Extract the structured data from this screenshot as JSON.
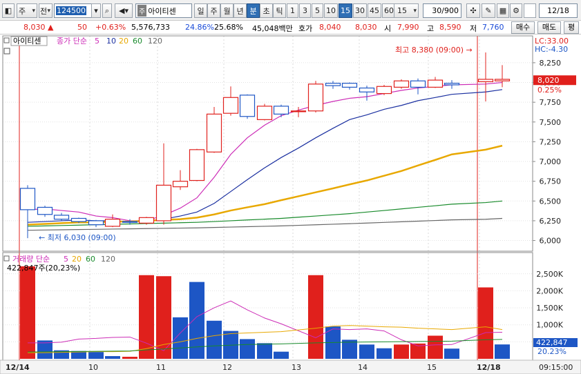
{
  "toolbar": {
    "period_select": "주",
    "prev_label": "전",
    "stock_code": "124500",
    "stock_name_tag": "주",
    "stock_name": "아이티센",
    "period_tabs": [
      "일",
      "주",
      "월",
      "년",
      "분",
      "초",
      "틱"
    ],
    "active_period": "분",
    "interval_tabs": [
      "1",
      "3",
      "5",
      "10",
      "15",
      "30",
      "45",
      "60"
    ],
    "active_interval": "15",
    "interval_select": "15",
    "count_value": "30/900",
    "date_value": "12/18"
  },
  "info": {
    "price": "8,030",
    "change": "50",
    "change_pct": "+0.63%",
    "volume": "5,576,733",
    "turnover_pct": "24.86%",
    "ratio_pct": "25.68%",
    "amount": "45,048백만",
    "quote_label": "호가",
    "ask": "8,040",
    "bid": "8,030",
    "open_label": "시",
    "open": "7,990",
    "high_label": "고",
    "high": "8,590",
    "low_label": "저",
    "low": "7,760",
    "buy_button": "매수",
    "sell_button": "매도",
    "eval_button": "평"
  },
  "colors": {
    "up": "#e0201c",
    "down": "#1d56c5",
    "ma5": "#cc2bb6",
    "ma10": "#1a2fa0",
    "ma20": "#e8a800",
    "ma60": "#178a2a",
    "ma120": "#666666"
  },
  "price_panel": {
    "legend_name": "아이티센",
    "legend_title": "종가 단순",
    "periods": [
      "5",
      "10",
      "20",
      "60",
      "120"
    ],
    "lc_label": "LC:33.00",
    "hc_label": "HC:-4.30",
    "current_price_tag": "8,020",
    "current_pct_tag": "0.25%",
    "high_annotation": "최고 8,380 (09:00)",
    "low_annotation": "최저 6,030 (09:00)"
  },
  "volume_panel": {
    "legend_title": "거래량 단순",
    "periods": [
      "5",
      "20",
      "60",
      "120"
    ],
    "value_label": "422,847주(20,23%)",
    "current_tag": "422,847",
    "current_pct_tag": "20.23%"
  },
  "time_axis": {
    "labels": [
      "12/14",
      "10",
      "11",
      "12",
      "13",
      "14",
      "15",
      "12/18"
    ],
    "corner_time": "09:15:00"
  },
  "chart_data": {
    "type": "candlestick",
    "price_axis": {
      "ticks": [
        "8,250",
        "8,000",
        "7,750",
        "7,500",
        "7,250",
        "7,000",
        "6,750",
        "6,500",
        "6,250",
        "6,000"
      ],
      "min": 5900,
      "max": 8450
    },
    "candles": [
      {
        "o": 6390,
        "h": 6700,
        "l": 6030,
        "c": 6660,
        "up": false
      },
      {
        "o": 6420,
        "h": 6440,
        "l": 6300,
        "c": 6330,
        "up": false
      },
      {
        "o": 6320,
        "h": 6350,
        "l": 6250,
        "c": 6270,
        "up": false
      },
      {
        "o": 6280,
        "h": 6290,
        "l": 6220,
        "c": 6240,
        "up": false
      },
      {
        "o": 6250,
        "h": 6260,
        "l": 6170,
        "c": 6200,
        "up": false
      },
      {
        "o": 6180,
        "h": 6330,
        "l": 6170,
        "c": 6270,
        "up": true
      },
      {
        "o": 6230,
        "h": 6270,
        "l": 6200,
        "c": 6240,
        "up": false
      },
      {
        "o": 6220,
        "h": 6300,
        "l": 6200,
        "c": 6290,
        "up": true
      },
      {
        "o": 6250,
        "h": 7230,
        "l": 6200,
        "c": 6700,
        "up": true
      },
      {
        "o": 6680,
        "h": 6890,
        "l": 6640,
        "c": 6750,
        "up": true
      },
      {
        "o": 6760,
        "h": 7160,
        "l": 6750,
        "c": 7150,
        "up": true
      },
      {
        "o": 7120,
        "h": 7690,
        "l": 7110,
        "c": 7600,
        "up": true
      },
      {
        "o": 7610,
        "h": 7950,
        "l": 7580,
        "c": 7810,
        "up": true
      },
      {
        "o": 7840,
        "h": 7850,
        "l": 7540,
        "c": 7570,
        "up": false
      },
      {
        "o": 7700,
        "h": 7730,
        "l": 7520,
        "c": 7530,
        "up": true
      },
      {
        "o": 7700,
        "h": 7720,
        "l": 7560,
        "c": 7600,
        "up": false
      },
      {
        "o": 7630,
        "h": 7690,
        "l": 7560,
        "c": 7640,
        "up": true
      },
      {
        "o": 7640,
        "h": 8020,
        "l": 7620,
        "c": 7980,
        "up": true
      },
      {
        "o": 7990,
        "h": 8020,
        "l": 7920,
        "c": 7960,
        "up": false
      },
      {
        "o": 7990,
        "h": 8000,
        "l": 7910,
        "c": 7940,
        "up": false
      },
      {
        "o": 7930,
        "h": 7960,
        "l": 7770,
        "c": 7880,
        "up": false
      },
      {
        "o": 7860,
        "h": 7970,
        "l": 7840,
        "c": 7950,
        "up": true
      },
      {
        "o": 7940,
        "h": 8040,
        "l": 7920,
        "c": 8020,
        "up": true
      },
      {
        "o": 8020,
        "h": 8050,
        "l": 7850,
        "c": 7940,
        "up": false
      },
      {
        "o": 7940,
        "h": 8070,
        "l": 7930,
        "c": 8030,
        "up": true
      },
      {
        "o": 7990,
        "h": 8030,
        "l": 7920,
        "c": 7970,
        "up": false
      },
      {
        "o": 8010,
        "h": 8380,
        "l": 7760,
        "c": 8040,
        "up": true
      },
      {
        "o": 8040,
        "h": 8220,
        "l": 7940,
        "c": 8020,
        "up": true
      }
    ],
    "ma_series": [
      {
        "period": "5",
        "values": [
          6390,
          6400,
          6380,
          6360,
          6310,
          6290,
          6250,
          6250,
          6320,
          6410,
          6540,
          6800,
          7090,
          7300,
          7460,
          7580,
          7650,
          7710,
          7760,
          7800,
          7820,
          7860,
          7900,
          7930,
          7950,
          7970,
          7980,
          8000
        ]
      },
      {
        "period": "10",
        "values": [
          6230,
          6240,
          6250,
          6260,
          6250,
          6250,
          6240,
          6250,
          6270,
          6310,
          6360,
          6470,
          6620,
          6770,
          6920,
          7050,
          7170,
          7300,
          7420,
          7530,
          7590,
          7660,
          7710,
          7770,
          7810,
          7850,
          7880,
          7910
        ]
      },
      {
        "period": "20",
        "values": [
          6200,
          6210,
          6220,
          6230,
          6230,
          6240,
          6240,
          6250,
          6260,
          6270,
          6290,
          6330,
          6380,
          6420,
          6460,
          6510,
          6560,
          6610,
          6660,
          6710,
          6760,
          6820,
          6880,
          6950,
          7020,
          7090,
          7150,
          7200
        ]
      },
      {
        "period": "60",
        "values": [
          6180,
          6185,
          6190,
          6195,
          6200,
          6205,
          6210,
          6215,
          6220,
          6225,
          6230,
          6240,
          6250,
          6260,
          6270,
          6280,
          6295,
          6310,
          6325,
          6340,
          6360,
          6380,
          6400,
          6420,
          6440,
          6460,
          6480,
          6500
        ]
      },
      {
        "period": "120",
        "values": [
          6130,
          6133,
          6136,
          6139,
          6142,
          6145,
          6148,
          6151,
          6154,
          6157,
          6160,
          6165,
          6170,
          6175,
          6180,
          6185,
          6192,
          6199,
          6206,
          6213,
          6221,
          6229,
          6237,
          6245,
          6253,
          6261,
          6269,
          6280
        ]
      }
    ],
    "volume_axis": {
      "ticks": [
        "2,500K",
        "2,000K",
        "1,500K",
        "1,000K",
        "500K"
      ],
      "max": 2800000
    },
    "volumes": [
      2720000,
      540000,
      250000,
      230000,
      200000,
      80000,
      60000,
      2460000,
      2430000,
      1220000,
      2260000,
      1120000,
      820000,
      580000,
      460000,
      210000,
      2460000,
      950000,
      560000,
      420000,
      310000,
      420000,
      450000,
      680000,
      300000,
      2100000,
      422847
    ],
    "volume_up": [
      true,
      false,
      false,
      false,
      false,
      false,
      true,
      true,
      true,
      false,
      false,
      false,
      false,
      false,
      false,
      false,
      true,
      false,
      false,
      false,
      false,
      true,
      true,
      true,
      false,
      true,
      false
    ]
  }
}
